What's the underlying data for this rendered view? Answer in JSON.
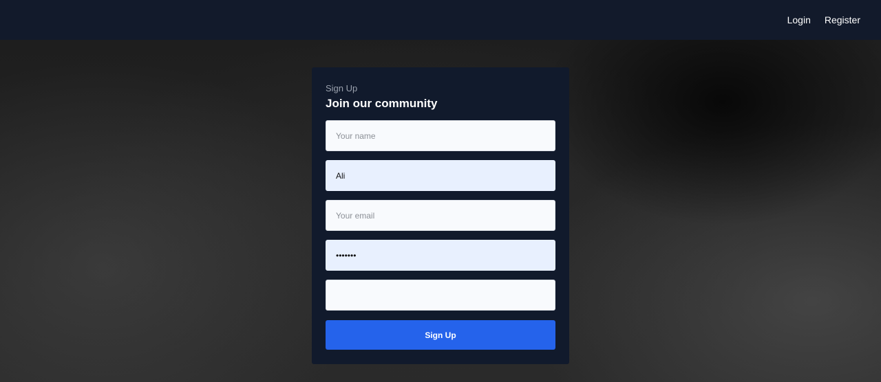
{
  "nav": {
    "login_label": "Login",
    "register_label": "Register"
  },
  "form": {
    "subtitle": "Sign Up",
    "title": "Join our community",
    "name_placeholder": "Your name",
    "username_value": "Ali",
    "email_placeholder": "Your email",
    "password_value": "•••••••",
    "extra_value": "",
    "submit_label": "Sign Up"
  },
  "colors": {
    "navbar": "#121a2b",
    "card": "#111a2c",
    "accent": "#2563eb"
  }
}
